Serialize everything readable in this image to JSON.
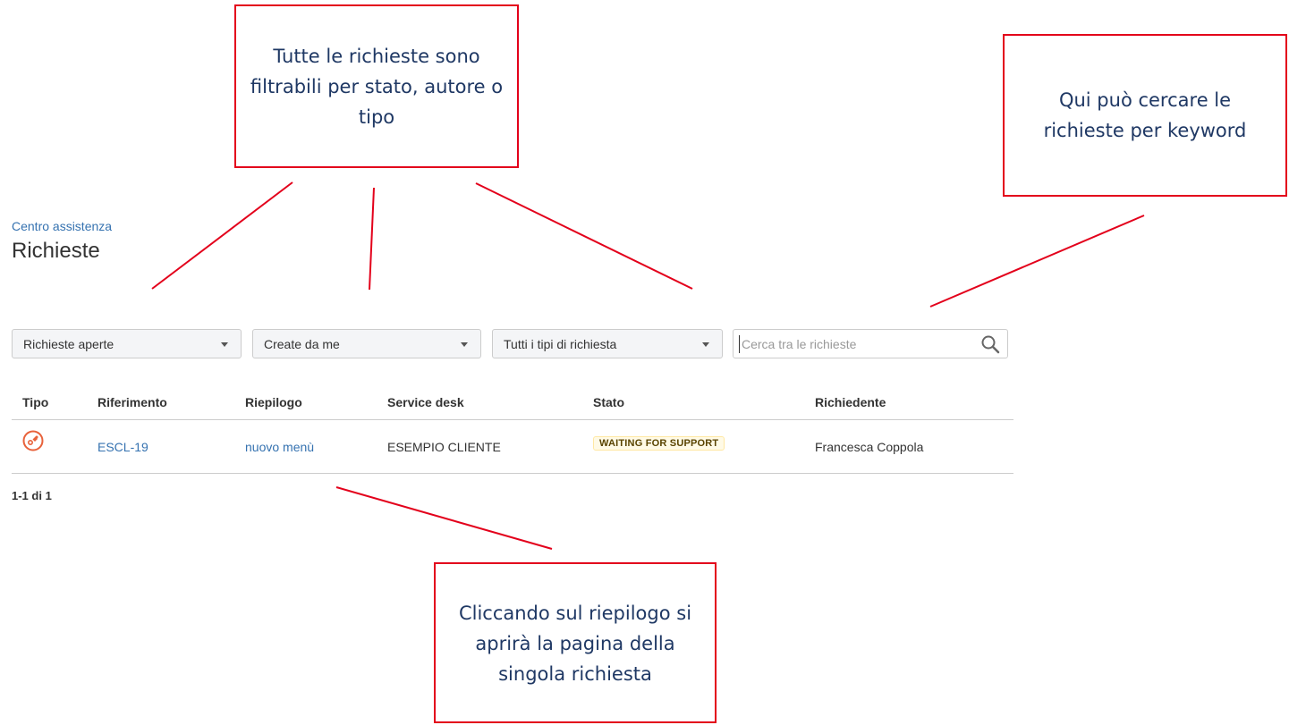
{
  "annotations": {
    "filters": "Tutte le richieste sono filtrabili per stato, autore o tipo",
    "search": "Qui può cercare le richieste per keyword",
    "summary": "Cliccando sul riepilogo si aprirà la pagina della singola richiesta",
    "border_color": "#e3001b",
    "text_color": "#1f3864"
  },
  "header": {
    "breadcrumb": "Centro assistenza",
    "title": "Richieste"
  },
  "filters": {
    "status": "Richieste aperte",
    "creator": "Create da me",
    "request_type": "Tutti i tipi di richiesta"
  },
  "search": {
    "placeholder": "Cerca tra le richieste",
    "icon": "search-icon"
  },
  "table": {
    "columns": [
      "Tipo",
      "Riferimento",
      "Riepilogo",
      "Service desk",
      "Stato",
      "Richiedente"
    ],
    "rows": [
      {
        "type_icon": "request-type-icon",
        "reference": "ESCL-19",
        "summary": "nuovo menù",
        "service_desk": "ESEMPIO CLIENTE",
        "status": "WAITING FOR SUPPORT",
        "requester": "Francesca Coppola"
      }
    ]
  },
  "pagination": "1-1 di 1",
  "colors": {
    "link": "#3572b0",
    "icon_orange": "#e8623b",
    "status_lozenge_bg": "#fffae6"
  }
}
